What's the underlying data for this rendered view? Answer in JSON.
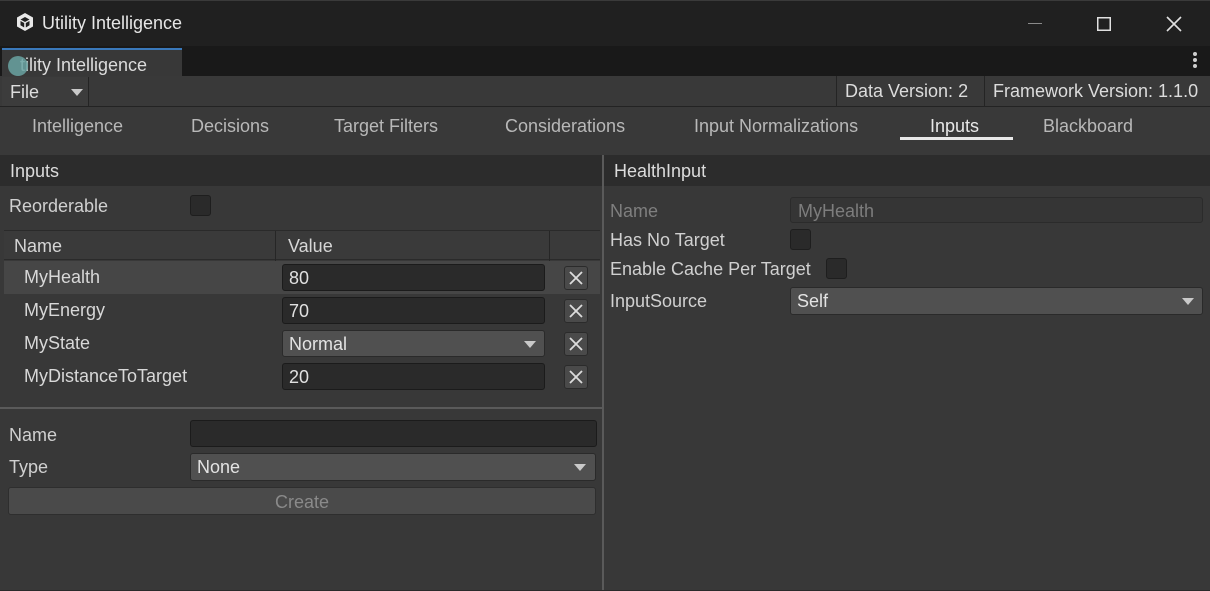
{
  "window": {
    "title": "Utility Intelligence",
    "icon": "unity-cube-icon"
  },
  "doc_tab": {
    "label": "tility Intelligence"
  },
  "toolbar": {
    "file_label": "File",
    "data_version": "Data Version: 2",
    "framework_version": "Framework Version: 1.1.0"
  },
  "tabs": [
    {
      "label": "Intelligence",
      "active": false
    },
    {
      "label": "Decisions",
      "active": false
    },
    {
      "label": "Target Filters",
      "active": false
    },
    {
      "label": "Considerations",
      "active": false
    },
    {
      "label": "Input Normalizations",
      "active": false
    },
    {
      "label": "Inputs",
      "active": true
    },
    {
      "label": "Blackboard",
      "active": false
    }
  ],
  "left_panel": {
    "header": "Inputs",
    "reorderable_label": "Reorderable",
    "reorderable_checked": false,
    "columns": {
      "name": "Name",
      "value": "Value"
    },
    "rows": [
      {
        "name": "MyHealth",
        "value": "80",
        "kind": "field",
        "selected": true
      },
      {
        "name": "MyEnergy",
        "value": "70",
        "kind": "field",
        "selected": false
      },
      {
        "name": "MyState",
        "value": "Normal",
        "kind": "dropdown",
        "selected": false
      },
      {
        "name": "MyDistanceToTarget",
        "value": "20",
        "kind": "field",
        "selected": false
      }
    ],
    "create_form": {
      "name_label": "Name",
      "name_value": "",
      "type_label": "Type",
      "type_value": "None",
      "create_label": "Create"
    }
  },
  "right_panel": {
    "header": "HealthInput",
    "name_label": "Name",
    "name_value": "MyHealth",
    "has_no_target_label": "Has No Target",
    "has_no_target_checked": false,
    "enable_cache_label": "Enable Cache Per Target",
    "enable_cache_checked": false,
    "input_source_label": "InputSource",
    "input_source_value": "Self"
  },
  "colors": {
    "accent_tab": "#3a79bb",
    "panel_bg": "#383838",
    "header_bg": "#2c2c2c"
  }
}
